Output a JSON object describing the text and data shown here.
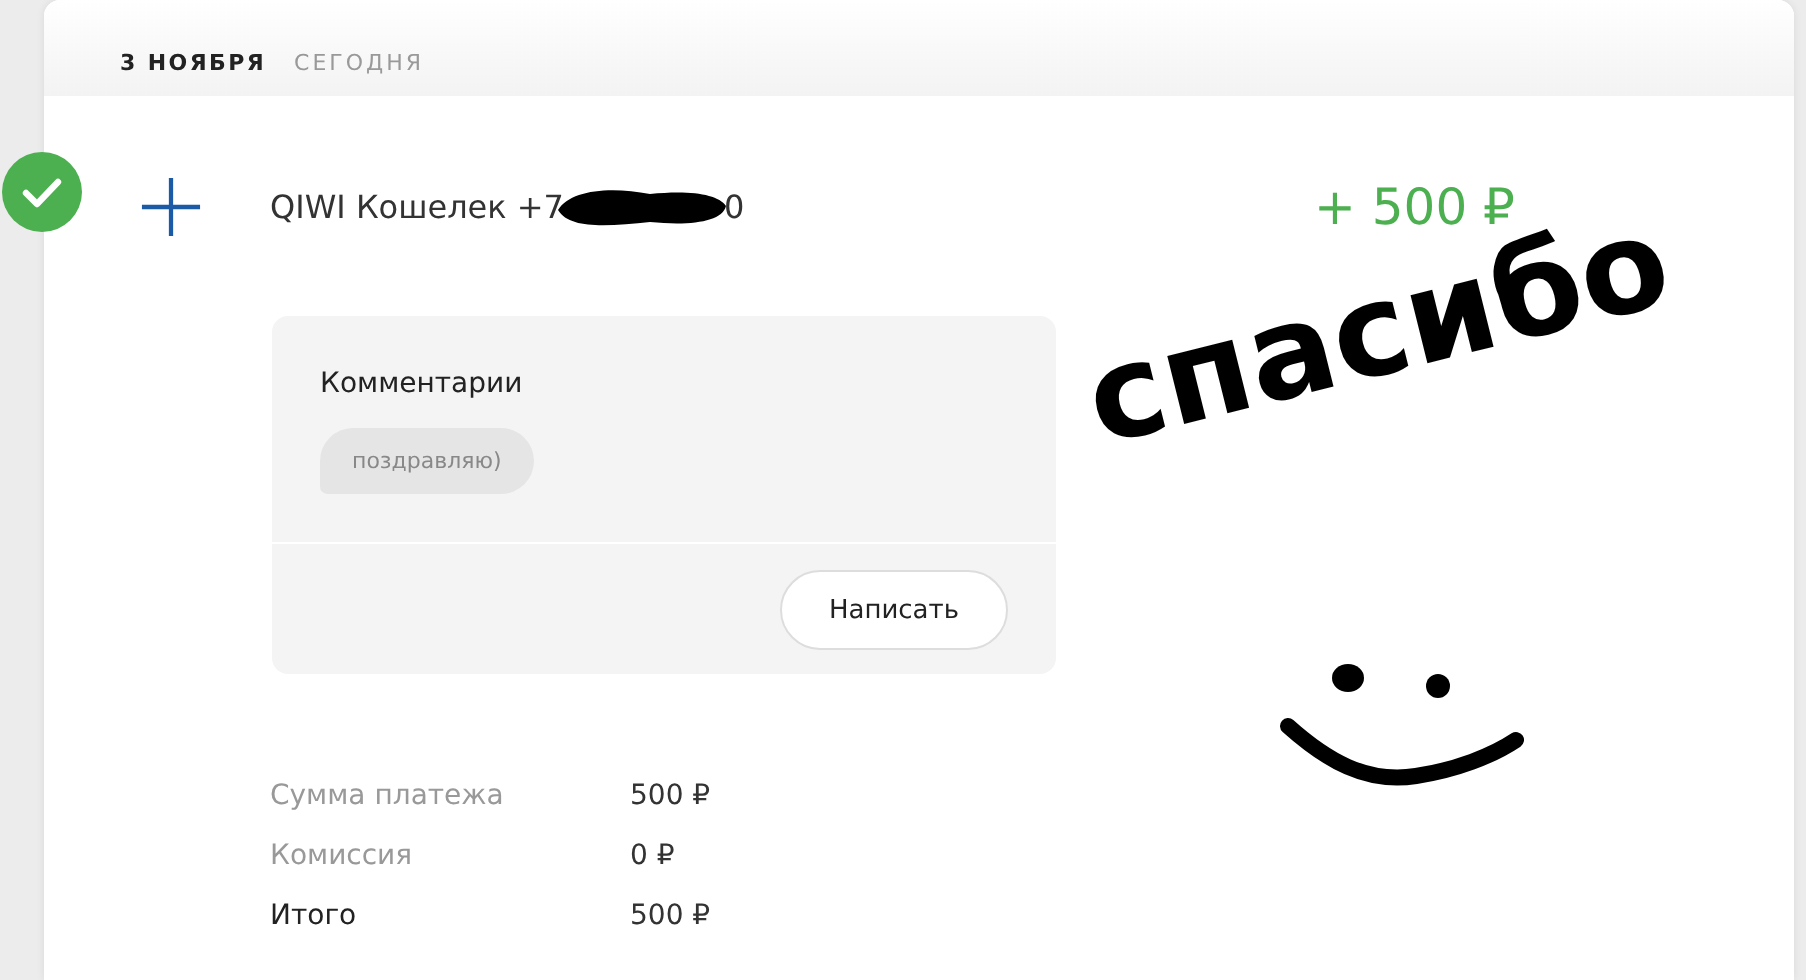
{
  "header": {
    "date": "3 НОЯБРЯ",
    "relative_day": "СЕГОДНЯ"
  },
  "transaction": {
    "status_done": true,
    "title_start": "QIWI Кошелек +7",
    "title_end": "0",
    "amount": "+ 500 ₽"
  },
  "comments": {
    "title": "Комментарии",
    "messages": [
      "поздравляю)"
    ],
    "button": "Написать"
  },
  "summary": [
    {
      "label": "Сумма платежа",
      "value": "500 ₽",
      "kind": "normal"
    },
    {
      "label": "Комиссия",
      "value": "0 ₽",
      "kind": "normal"
    },
    {
      "label": "Итого",
      "value": "500 ₽",
      "kind": "total"
    }
  ],
  "handwriting": {
    "text": "спасибо"
  }
}
